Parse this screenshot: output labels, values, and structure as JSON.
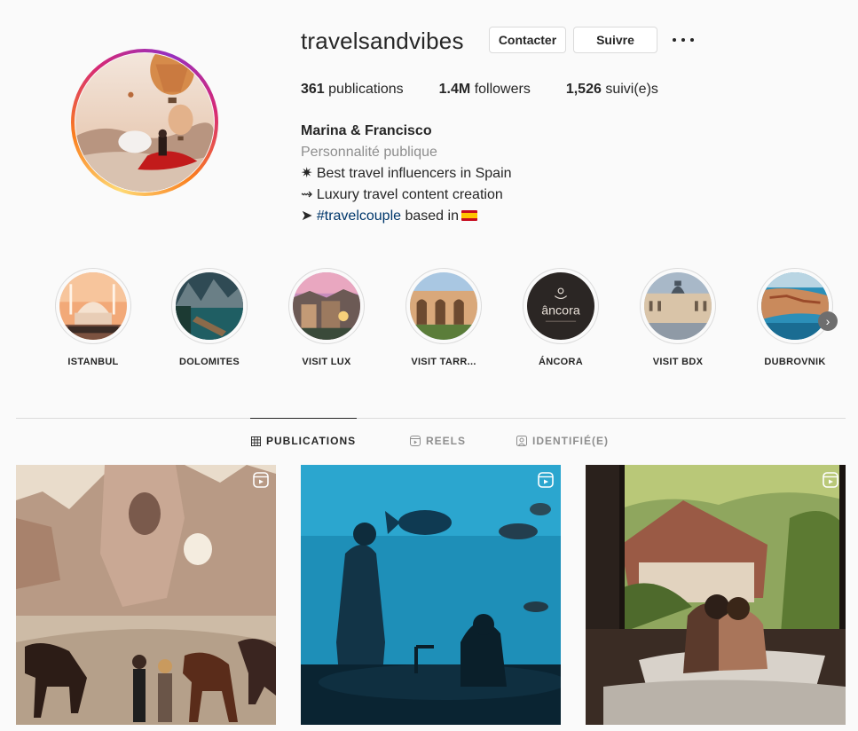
{
  "profile": {
    "username": "travelsandvibes",
    "contact_label": "Contacter",
    "follow_label": "Suivre",
    "stats": {
      "posts_count": "361",
      "posts_label": "publications",
      "followers_count": "1.4M",
      "followers_label": "followers",
      "following_count": "1,526",
      "following_label": "suivi(e)s"
    },
    "bio": {
      "name": "Marina & Francisco",
      "category": "Personnalité publique",
      "line1": "✷ Best travel influencers in Spain",
      "line2": "⇝ Luxury travel content creation",
      "line3_prefix": "➤ ",
      "line3_hashtag": "#travelcouple",
      "line3_suffix": " based in"
    }
  },
  "highlights": [
    {
      "label": "ISTANBUL"
    },
    {
      "label": "DOLOMITES"
    },
    {
      "label": "VISIT LUX"
    },
    {
      "label": "VISIT TARR..."
    },
    {
      "label": "ÁNCORA",
      "logo_text": "âncora"
    },
    {
      "label": "VISIT BDX"
    },
    {
      "label": "DUBROVNIK"
    }
  ],
  "tabs": [
    {
      "label": "PUBLICATIONS",
      "icon": "grid-icon",
      "active": true
    },
    {
      "label": "REELS",
      "icon": "reels-icon",
      "active": false
    },
    {
      "label": "IDENTIFIÉ(E)",
      "icon": "tagged-icon",
      "active": false
    }
  ],
  "posts": [
    {
      "type": "reel",
      "scene": "cappadocia-horses"
    },
    {
      "type": "reel",
      "scene": "aquarium-bath"
    },
    {
      "type": "reel",
      "scene": "window-bathtub"
    }
  ]
}
